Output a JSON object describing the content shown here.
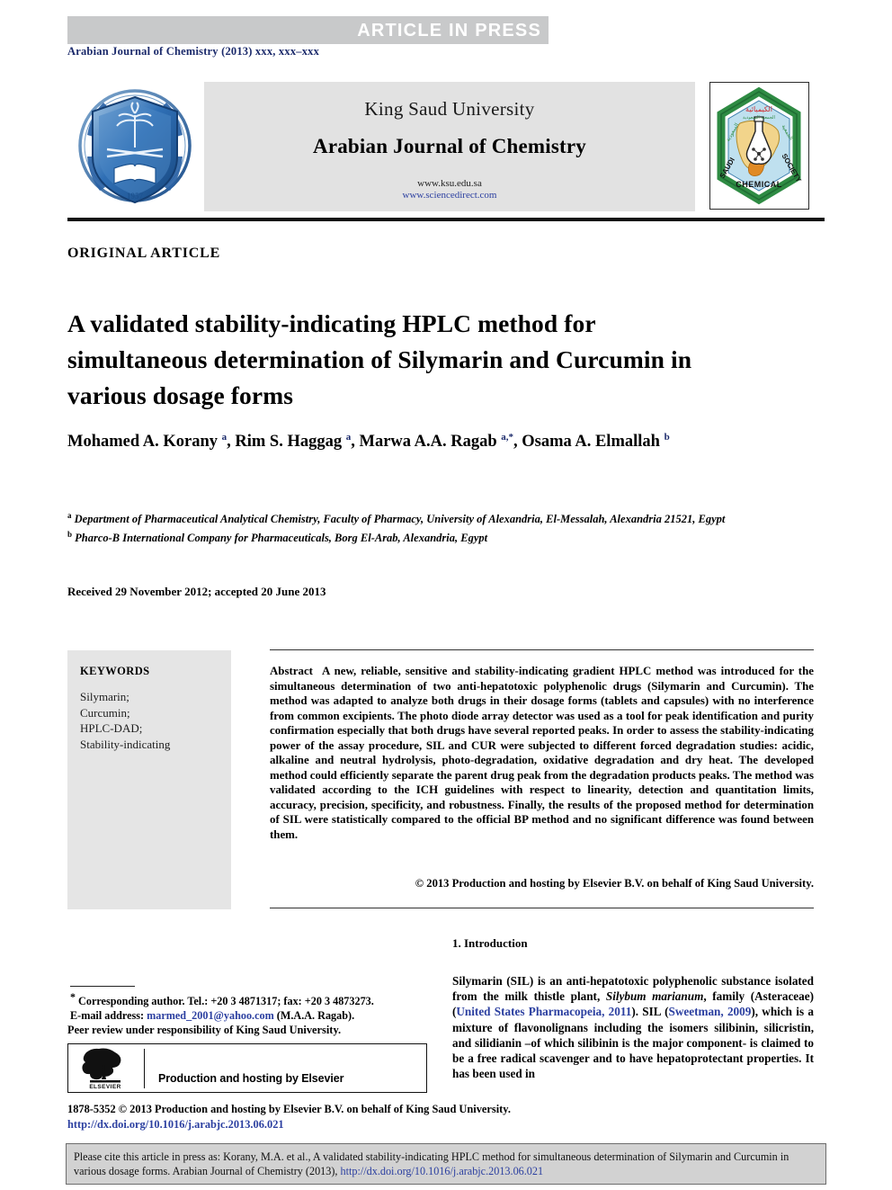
{
  "banner": {
    "text": "ARTICLE  IN  PRESS",
    "bg_color": "#c8c9ca",
    "text_color": "#ffffff"
  },
  "journal_ref": "Arabian Journal of Chemistry (2013) xxx, xxx–xxx",
  "masthead": {
    "university": "King Saud University",
    "journal_title": "Arabian Journal of Chemistry",
    "url_primary": "www.ksu.edu.sa",
    "url_secondary": "www.sciencedirect.com",
    "left_logo_name": "king-saud-university-logo",
    "left_logo_alt_text": "King Saud University 1957",
    "right_logo_name": "saudi-chemical-society-logo",
    "right_logo_alt_text": "SAUDI CHEMICAL SOCIETY",
    "panel_bg": "#e2e2e2",
    "link_color": "#2b3fa0"
  },
  "section_label": "ORIGINAL ARTICLE",
  "title": "A validated stability-indicating HPLC method for simultaneous determination of Silymarin and Curcumin in various dosage forms",
  "authors": [
    {
      "name": "Mohamed A. Korany",
      "sup": "a",
      "sep": ", "
    },
    {
      "name": "Rim S. Haggag",
      "sup": "a",
      "sep": ", "
    },
    {
      "name": "Marwa A.A. Ragab",
      "sup": "a,*",
      "sep": ", "
    },
    {
      "name": "Osama A. Elmallah",
      "sup": "b",
      "sep": ""
    }
  ],
  "affiliations": [
    {
      "mark": "a",
      "text": "Department of Pharmaceutical Analytical Chemistry, Faculty of Pharmacy, University of Alexandria, El-Messalah, Alexandria 21521, Egypt"
    },
    {
      "mark": "b",
      "text": "Pharco-B International Company for Pharmaceuticals, Borg El-Arab, Alexandria, Egypt"
    }
  ],
  "received_line": "Received 29 November 2012; accepted 20 June 2013",
  "keywords": {
    "heading": "KEYWORDS",
    "items": [
      "Silymarin;",
      "Curcumin;",
      "HPLC-DAD;",
      "Stability-indicating"
    ],
    "bg_color": "#e5e5e5"
  },
  "abstract": {
    "label": "Abstract",
    "body": "A new, reliable, sensitive and stability-indicating gradient HPLC method was introduced for the simultaneous determination of two anti-hepatotoxic polyphenolic drugs (Silymarin and Curcumin). The method was adapted to analyze both drugs in their dosage forms (tablets and capsules) with no interference from common excipients. The photo diode array detector was used as a tool for peak identification and purity confirmation especially that both drugs have several reported peaks. In order to assess the stability-indicating power of the assay procedure, SIL and CUR were subjected to different forced degradation studies: acidic, alkaline and neutral hydrolysis, photo-degradation, oxidative degradation and dry heat. The developed method could efficiently separate the parent drug peak from the degradation products peaks. The method was validated according to the ICH guidelines with respect to linearity, detection and quantitation limits, accuracy, precision, specificity, and robustness. Finally, the results of the proposed method for determination of SIL were statistically compared to the official BP method and no significant difference was found between them.",
    "copyright": "© 2013 Production and hosting by Elsevier B.V. on behalf of King Saud University."
  },
  "introduction": {
    "heading": "1. Introduction",
    "paragraph_parts": [
      {
        "t": "Silymarin (SIL) is an anti-hepatotoxic polyphenolic substance isolated from the milk thistle plant, ",
        "style": "normal"
      },
      {
        "t": "Silybum marianum",
        "style": "italic"
      },
      {
        "t": ", family (Asteraceae) (",
        "style": "normal"
      },
      {
        "t": "United States Pharmacopeia, 2011",
        "style": "ref"
      },
      {
        "t": "). SIL (",
        "style": "normal"
      },
      {
        "t": "Sweetman, 2009",
        "style": "ref"
      },
      {
        "t": "), which is a mixture of flavonolignans including the isomers silibinin, silicristin, and silidianin –of which silibinin is the major component- is claimed to be a free radical scavenger and to have hepatoprotectant properties. It has been used in",
        "style": "normal"
      }
    ]
  },
  "footnote": {
    "corresponding_mark": "*",
    "corresponding": "Corresponding author. Tel.: +20 3 4871317; fax: +20 3 4873273.",
    "email_label": "E-mail address:",
    "email": "marmed_2001@yahoo.com",
    "email_owner": "(M.A.A. Ragab).",
    "peer_review": "Peer review under responsibility of King Saud University."
  },
  "elsevier_box": {
    "logo_name": "elsevier-tree-logo",
    "logo_wordmark": "ELSEVIER",
    "text": "Production and hosting by Elsevier"
  },
  "issn_line": "1878-5352 © 2013 Production and hosting by Elsevier B.V. on behalf of King Saud University.",
  "doi_line": "http://dx.doi.org/10.1016/j.arabjc.2013.06.021",
  "citation_box": {
    "text_before": "Please cite this article in press as: Korany, M.A. et al., A validated stability-indicating HPLC method for simultaneous determination of Silymarin and Curcumin in various dosage forms. Arabian Journal of Chemistry (2013), ",
    "doi": "http://dx.doi.org/10.1016/j.arabjc.2013.06.021",
    "bg_color": "#d2d2d2"
  }
}
